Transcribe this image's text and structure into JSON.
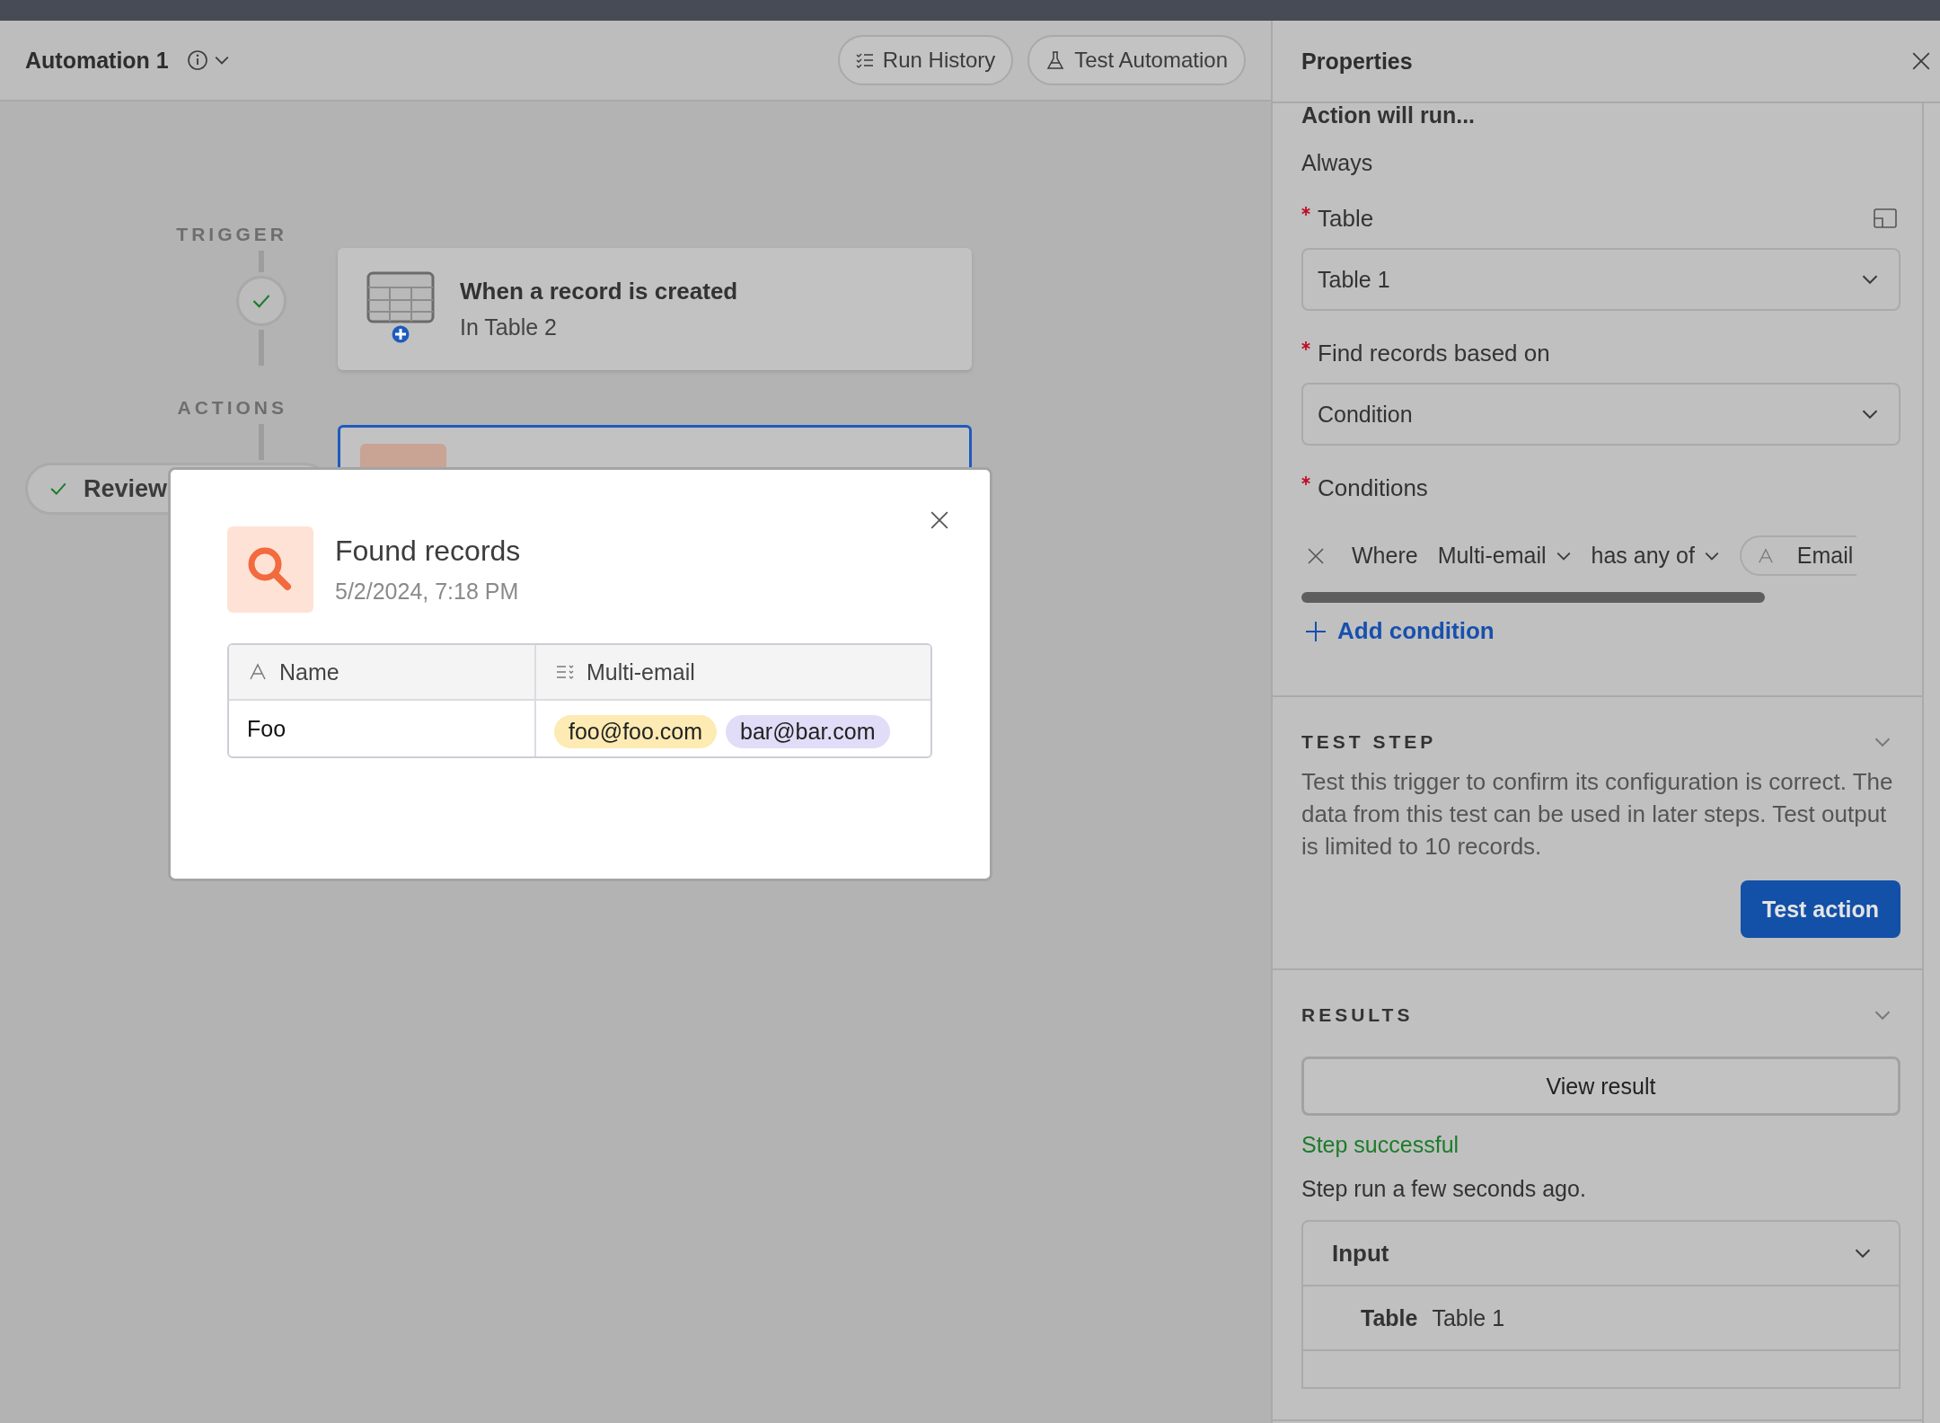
{
  "header": {
    "title": "Automation 1",
    "buttons": [
      {
        "label": "Run History",
        "kind": "history"
      },
      {
        "label": "Test Automation",
        "kind": "flask"
      }
    ]
  },
  "canvas": {
    "trigger_label": "TRIGGER",
    "trigger": {
      "title": "When a record is created",
      "subtitle": "In Table 2",
      "done": true
    },
    "actions_label": "ACTIONS",
    "action": {
      "selected": true
    },
    "review": {
      "label": "Review",
      "done": true
    }
  },
  "modal": {
    "title": "Found records",
    "date": "5/2/2024, 7:18 PM",
    "columns": [
      {
        "label": "Name",
        "kind": "text"
      },
      {
        "label": "Multi-email",
        "kind": "multi"
      }
    ],
    "rows": [
      {
        "name": "Foo",
        "emails": [
          {
            "label": "foo@foo.com",
            "color": "#fdebb3"
          },
          {
            "label": "bar@bar.com",
            "color": "#e1dcf7"
          }
        ]
      }
    ]
  },
  "properties": {
    "title": "Properties",
    "run_label": "Action will run...",
    "run_value": "Always",
    "fields": [
      {
        "label": "Table",
        "value": "Table 1",
        "required": true,
        "side_icon": true
      },
      {
        "label": "Find records based on",
        "value": "Condition",
        "required": true,
        "side_icon": false
      }
    ],
    "conditions": {
      "label": "Conditions",
      "required": true,
      "where": "Where",
      "field": "Multi-email",
      "operator": "has any of",
      "value": "Email",
      "add": "Add condition"
    },
    "test_step": {
      "heading": "TEST STEP",
      "expanded": true,
      "text": "Test this trigger to confirm its configuration is correct. The data from this test can be used in later steps. Test output is limited to 10 records.",
      "button": "Test action"
    },
    "results": {
      "heading": "RESULTS",
      "expanded": true,
      "button": "View result",
      "status": "Step successful",
      "note": "Step run a few seconds ago.",
      "input": {
        "label": "Input",
        "expanded": true,
        "rows": [
          {
            "key": "Table",
            "value": "Table 1"
          }
        ]
      }
    }
  }
}
